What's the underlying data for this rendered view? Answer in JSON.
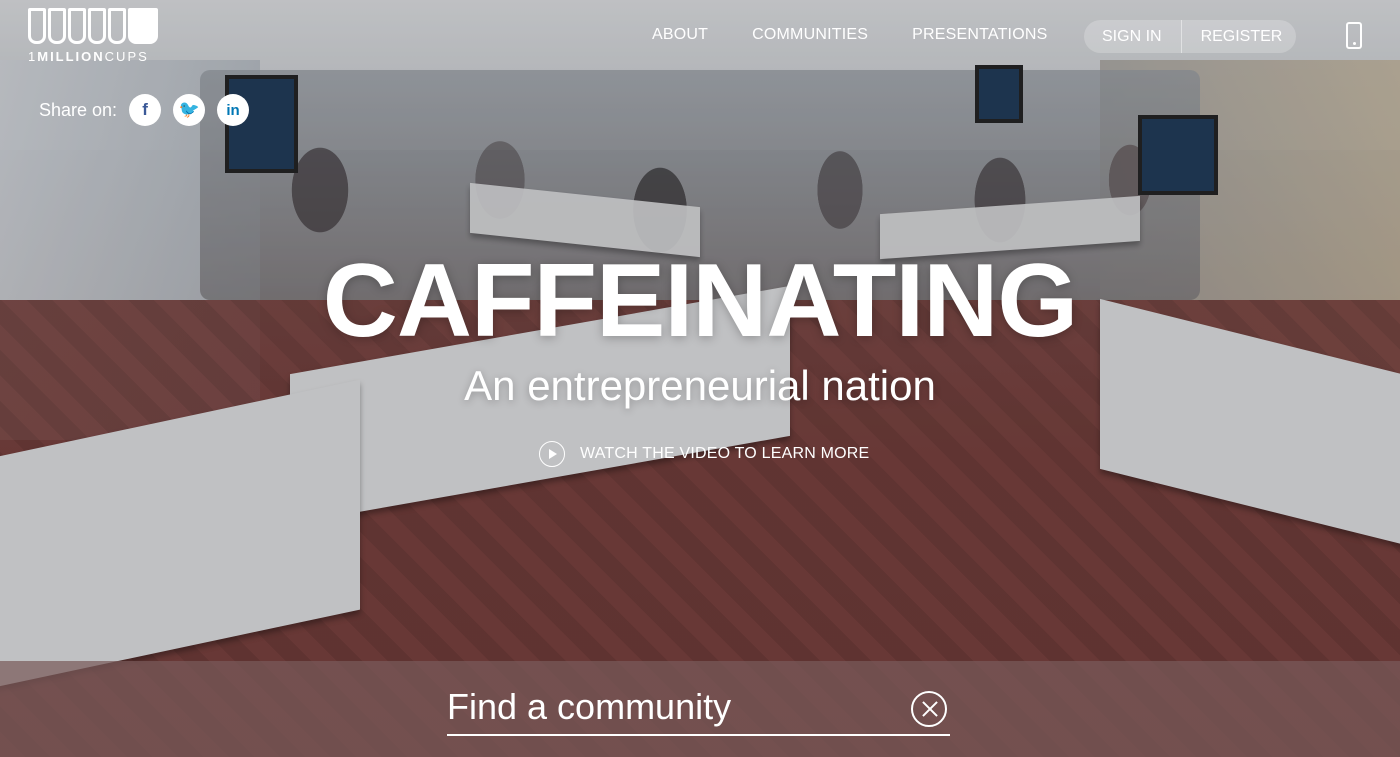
{
  "brand": {
    "logo_text_prefix": "1",
    "logo_text_main": "MILLION",
    "logo_text_suffix": "CUPS"
  },
  "nav": {
    "items": [
      "ABOUT",
      "COMMUNITIES",
      "PRESENTATIONS"
    ]
  },
  "auth": {
    "sign_in": "SIGN IN",
    "register": "REGISTER"
  },
  "share": {
    "label": "Share on:",
    "networks": [
      {
        "icon": "facebook-icon",
        "glyph": "f"
      },
      {
        "icon": "twitter-icon",
        "glyph": "🐦"
      },
      {
        "icon": "linkedin-icon",
        "glyph": "in"
      }
    ]
  },
  "hero": {
    "headline": "CAFFEINATING",
    "subhead": "An entrepreneurial nation",
    "cta": "WATCH THE VIDEO TO LEARN MORE"
  },
  "search": {
    "placeholder": "Find a community"
  },
  "colors": {
    "facebook": "#3b5998",
    "twitter": "#1da1f2",
    "linkedin": "#0077b5",
    "search_bar": "#785a5a"
  }
}
